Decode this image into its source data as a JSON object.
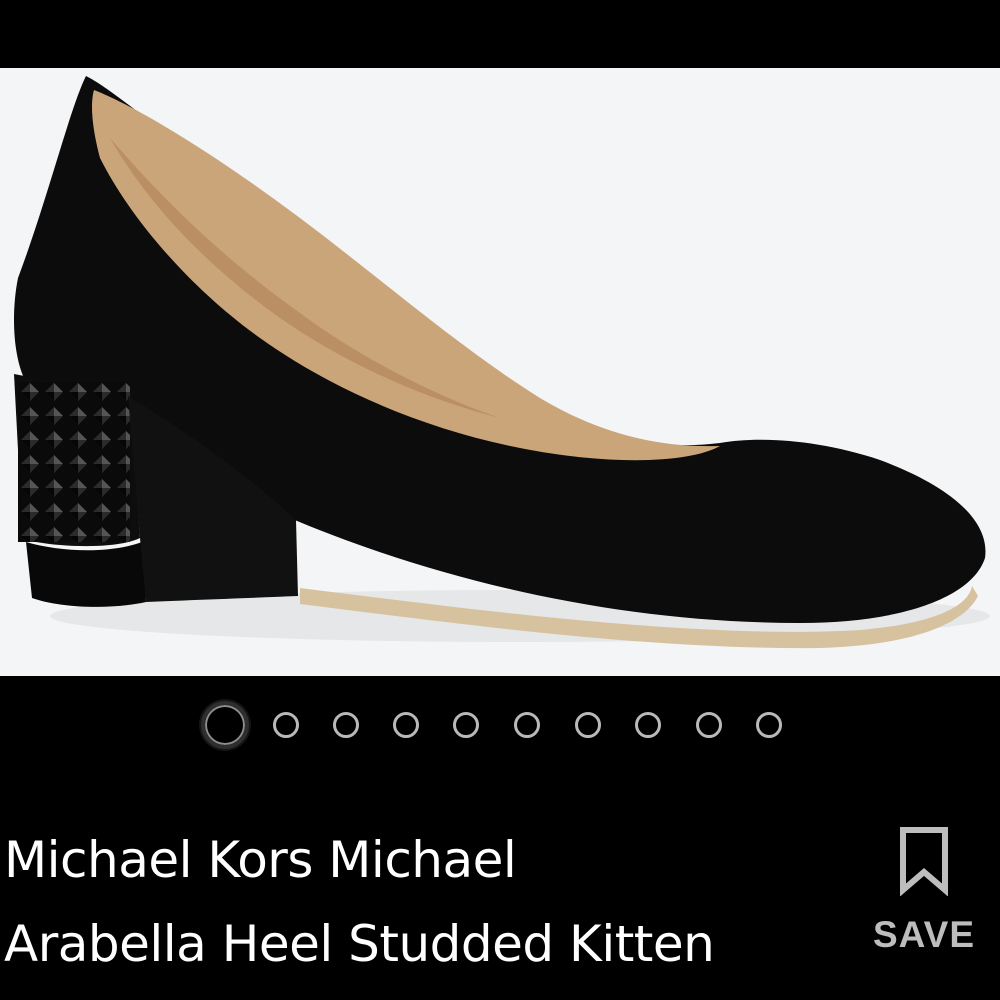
{
  "product": {
    "title_line_1": "Michael Kors Michael",
    "title_line_2": "Arabella Heel Studded Kitten",
    "image_icon": "black-suede-pump-with-studded-heel",
    "image_count": 10,
    "current_image_index": 1
  },
  "save": {
    "label": "SAVE",
    "icon": "bookmark-icon"
  },
  "colors": {
    "background": "#000000",
    "image_background": "#f4f5f6",
    "text": "#ffffff",
    "save_label": "#bdbdbd",
    "dot_inactive": "#b9b9b9"
  }
}
